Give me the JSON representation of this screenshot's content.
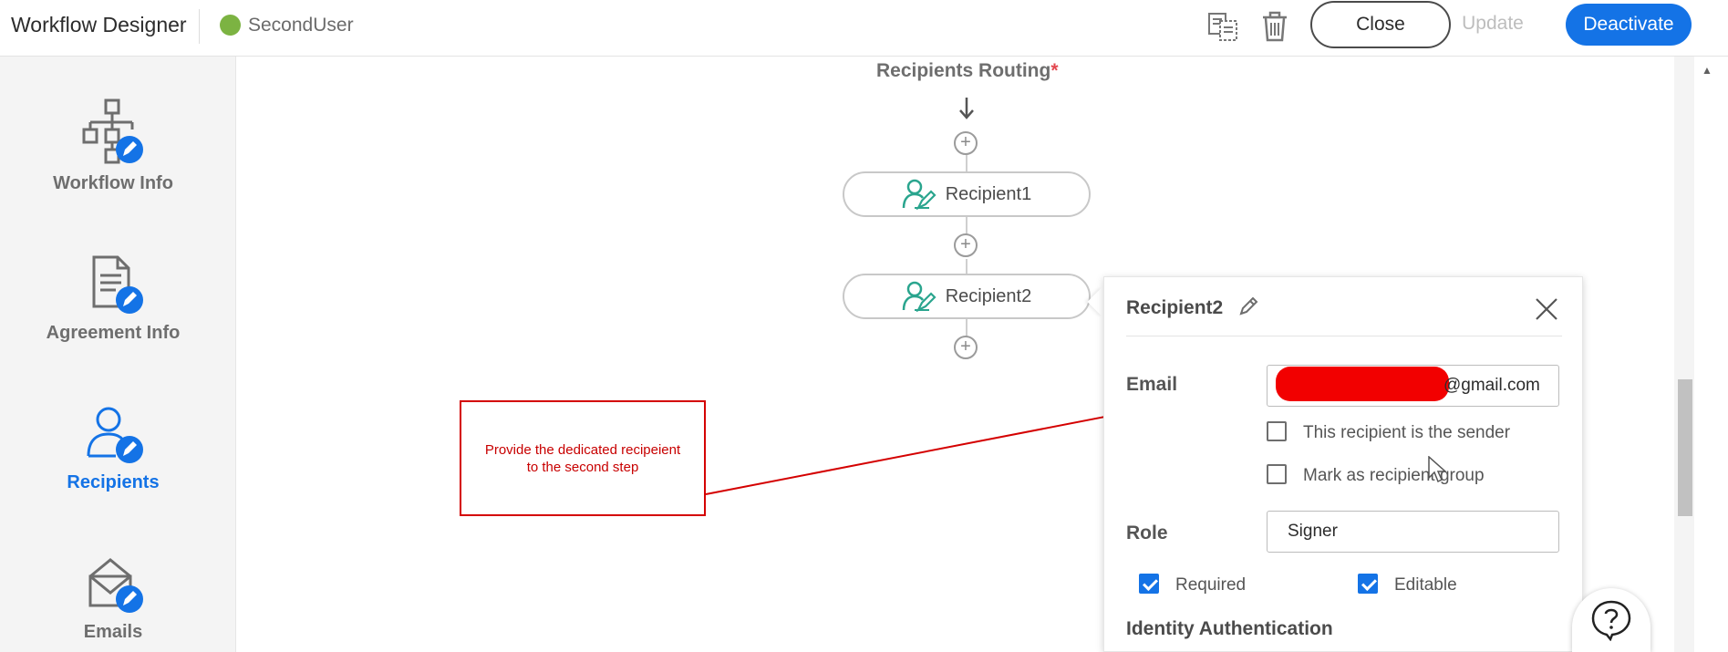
{
  "header": {
    "app_title": "Workflow Designer",
    "workflow_name": "SecondUser",
    "status_color": "#7cb342",
    "icons": [
      "copy-document-icon",
      "trash-icon"
    ],
    "close_label": "Close",
    "update_label": "Update",
    "deactivate_label": "Deactivate"
  },
  "sidebar": {
    "items": [
      {
        "label": "Workflow Info",
        "icon": "workflow-info-icon",
        "active": false
      },
      {
        "label": "Agreement Info",
        "icon": "agreement-info-icon",
        "active": false
      },
      {
        "label": "Recipients",
        "icon": "recipients-icon",
        "active": true
      },
      {
        "label": "Emails",
        "icon": "emails-icon",
        "active": false
      }
    ]
  },
  "routing": {
    "title": "Recipients Routing",
    "required_marker": "*",
    "steps": [
      {
        "label": "Recipient1",
        "icon": "signer-icon"
      },
      {
        "label": "Recipient2",
        "icon": "signer-icon"
      }
    ]
  },
  "annotation": {
    "text": "Provide the dedicated recipeient\nto the second step",
    "color": "#d40000"
  },
  "panel": {
    "title": "Recipient2",
    "email_label": "Email",
    "email_visible_suffix": "@gmail.com",
    "sender_checkbox_label": "This recipient is the sender",
    "sender_checked": false,
    "group_checkbox_label": "Mark as recipient group",
    "group_checked": false,
    "role_label": "Role",
    "role_value": "Signer",
    "required_label": "Required",
    "required_checked": true,
    "editable_label": "Editable",
    "editable_checked": true,
    "identity_title": "Identity Authentication"
  },
  "colors": {
    "accent": "#1473e6",
    "signer_icon": "#2aa58e"
  }
}
